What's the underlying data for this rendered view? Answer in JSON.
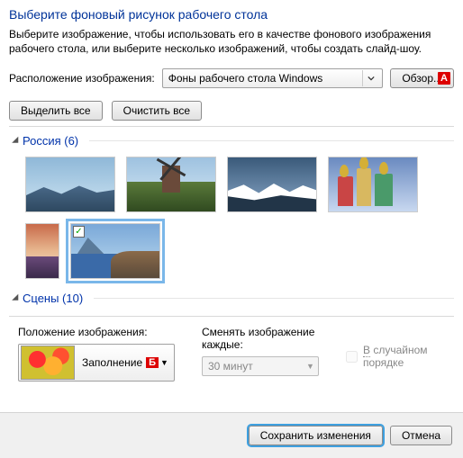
{
  "title": "Выберите фоновый рисунок рабочего стола",
  "subtitle": "Выберите изображение, чтобы использовать его в качестве фонового изображения рабочего стола, или выберите несколько изображений, чтобы создать слайд-шоу.",
  "location": {
    "label": "Расположение изображения:",
    "value": "Фоны рабочего стола Windows",
    "browse": "Обзор..."
  },
  "markers": {
    "a": "А",
    "b": "Б"
  },
  "actions": {
    "select_all": "Выделить все",
    "clear_all": "Очистить все"
  },
  "groups": [
    {
      "name": "Россия",
      "count": 6,
      "label": "Россия (6)"
    },
    {
      "name": "Сцены",
      "count": 10,
      "label": "Сцены (10)"
    }
  ],
  "position": {
    "label": "Положение изображения:",
    "mode": "Заполнение"
  },
  "interval": {
    "label": "Сменять изображение каждые:",
    "value": "30 минут"
  },
  "random": {
    "label_pre": "В",
    "label_rest": " случайном порядке"
  },
  "footer": {
    "save": "Сохранить изменения",
    "cancel": "Отмена"
  }
}
